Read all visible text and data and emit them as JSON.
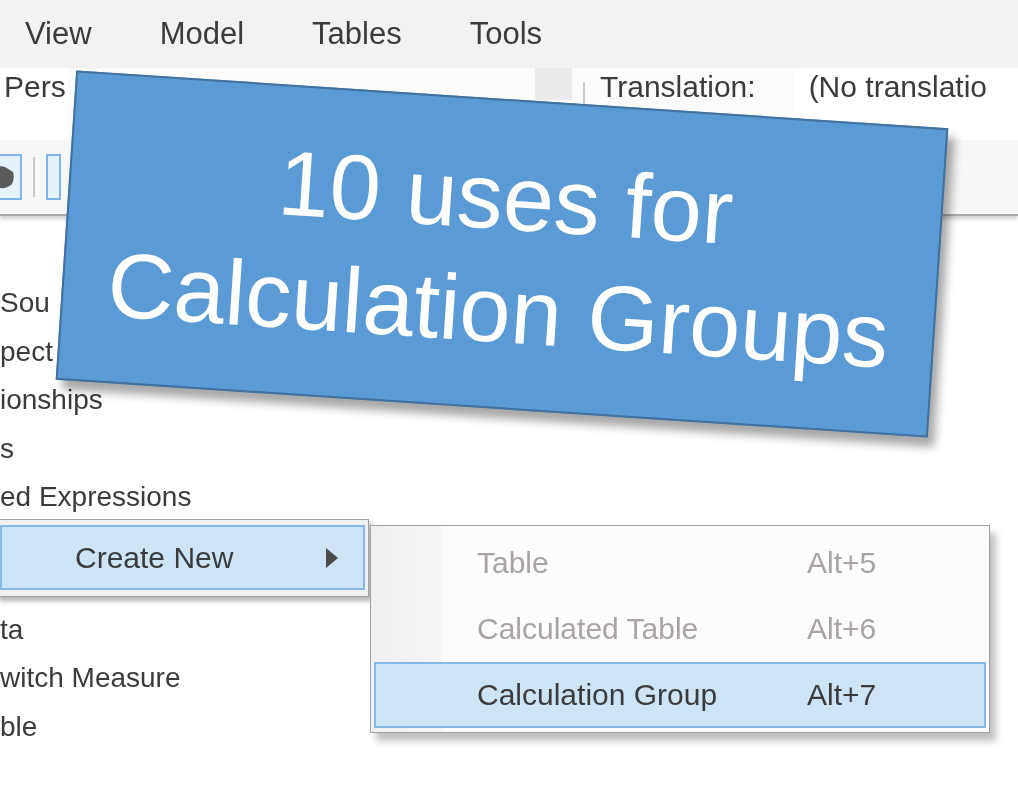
{
  "menu_bar": {
    "items": [
      "View",
      "Model",
      "Tables",
      "Tools"
    ]
  },
  "toolbar": {
    "perspective_value": "Pers",
    "translation_label": "Translation:",
    "translation_value": "(No translatio"
  },
  "tree": {
    "items_above_menu": [
      "Sou",
      "pect",
      "ionships",
      "s",
      "ed Expressions"
    ],
    "items_below_menu": [
      "ta",
      "witch Measure",
      "ble"
    ]
  },
  "context_menu": {
    "items": [
      {
        "label": "Create New",
        "selected": true,
        "has_submenu": true
      }
    ]
  },
  "submenu": {
    "items": [
      {
        "label": "Table",
        "shortcut": "Alt+5",
        "disabled": true,
        "selected": false
      },
      {
        "label": "Calculated Table",
        "shortcut": "Alt+6",
        "disabled": true,
        "selected": false
      },
      {
        "label": "Calculation Group",
        "shortcut": "Alt+7",
        "disabled": false,
        "selected": true
      }
    ]
  },
  "banner": {
    "title": "10 uses for Calculation Groups"
  }
}
